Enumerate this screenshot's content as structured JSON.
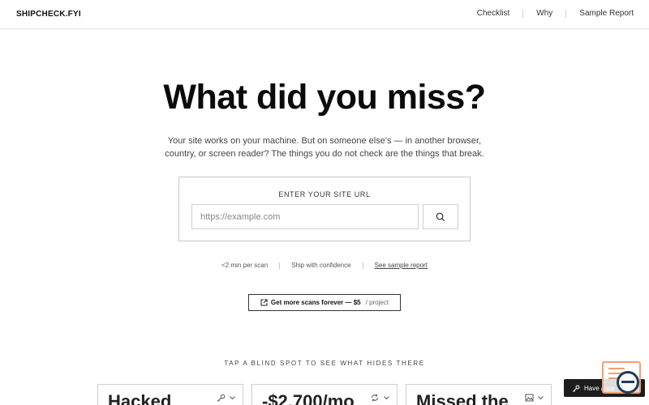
{
  "header": {
    "brand": "SHIPCHECK.FYI",
    "nav": [
      "Checklist",
      "Why",
      "Sample Report"
    ]
  },
  "hero": {
    "title": "What did you miss?",
    "subtitle": "Your site works on your machine. But on someone else's — in another browser, country, or screen reader? The things you do not check are the things that break."
  },
  "scan": {
    "label": "ENTER YOUR SITE URL",
    "placeholder": "https://example.com",
    "value": ""
  },
  "meta": {
    "time": "<2 min per scan",
    "confidence": "Ship with confidence",
    "sample_link": "See sample report"
  },
  "cta": {
    "main": "Get more scans forever — $5",
    "suffix": "/ project"
  },
  "blind_spots": {
    "label": "TAP A BLIND SPOT TO SEE WHAT HIDES THERE",
    "cards": [
      {
        "title": "Hacked",
        "icon": "key-icon"
      },
      {
        "title": "-$2,700/mo",
        "icon": "refresh-icon"
      },
      {
        "title": "Missed the",
        "icon": "image-icon"
      }
    ]
  },
  "feedback": {
    "label": "Have a ice"
  },
  "colors": {
    "text": "#111111",
    "border": "#cfcfcf",
    "widget_accent": "#f0a070",
    "widget_dark": "#1f3b5a"
  }
}
